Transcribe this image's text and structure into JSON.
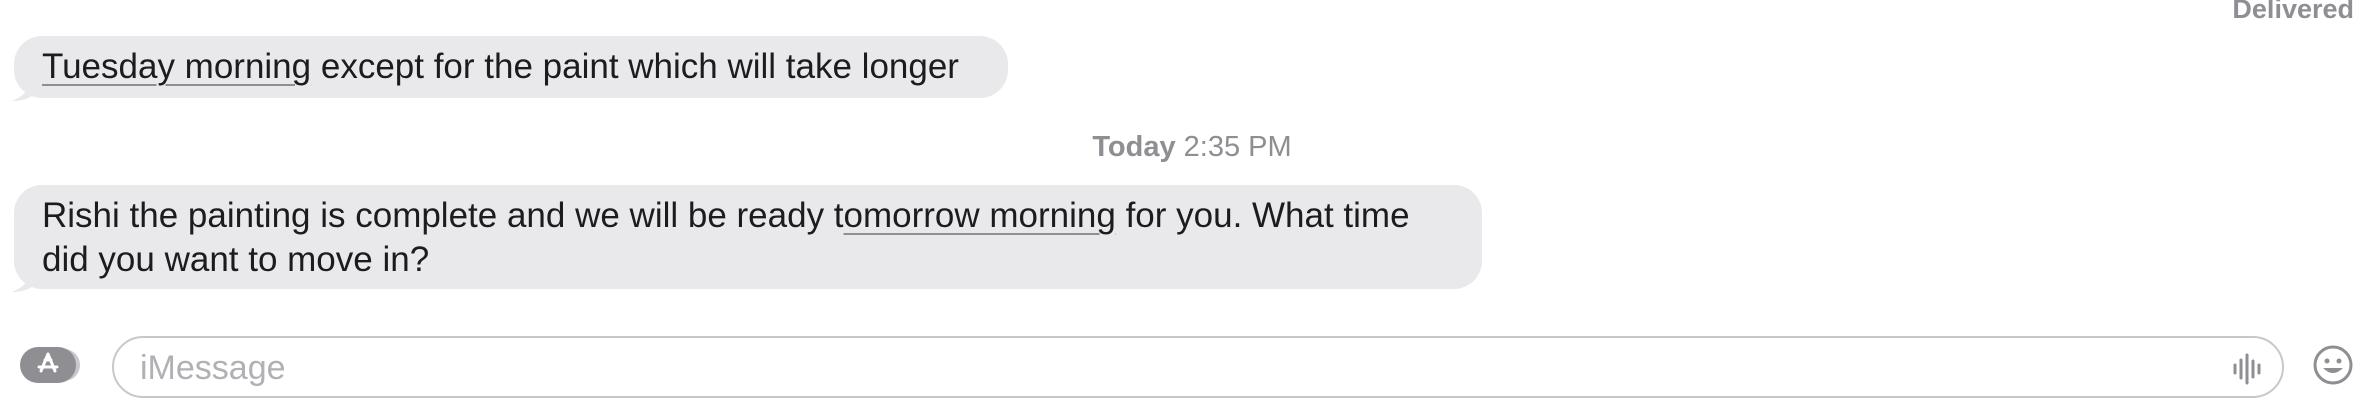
{
  "status": {
    "delivered_label": "Delivered"
  },
  "messages": [
    {
      "segments": [
        {
          "text": "Tuesday morning",
          "detected": true
        },
        {
          "text": " except for the paint which will take longer",
          "detected": false
        }
      ]
    },
    {
      "segments": [
        {
          "text": "Rishi the painting is complete and we will be ready t",
          "detected": false
        },
        {
          "text": "omorrow morning",
          "detected": true
        },
        {
          "text": " for you. What time did you want to move in?",
          "detected": false
        }
      ]
    }
  ],
  "timestamp": {
    "day": "Today",
    "time": "2:35 PM"
  },
  "composer": {
    "placeholder": "iMessage",
    "value": "",
    "app_icon": "app-store-icon",
    "voice_icon": "waveform-icon",
    "emoji_icon": "emoji-icon"
  },
  "colors": {
    "received_bubble": "#e9e9eb",
    "text": "#1c1c1e",
    "secondary_text": "#8e8e93"
  }
}
